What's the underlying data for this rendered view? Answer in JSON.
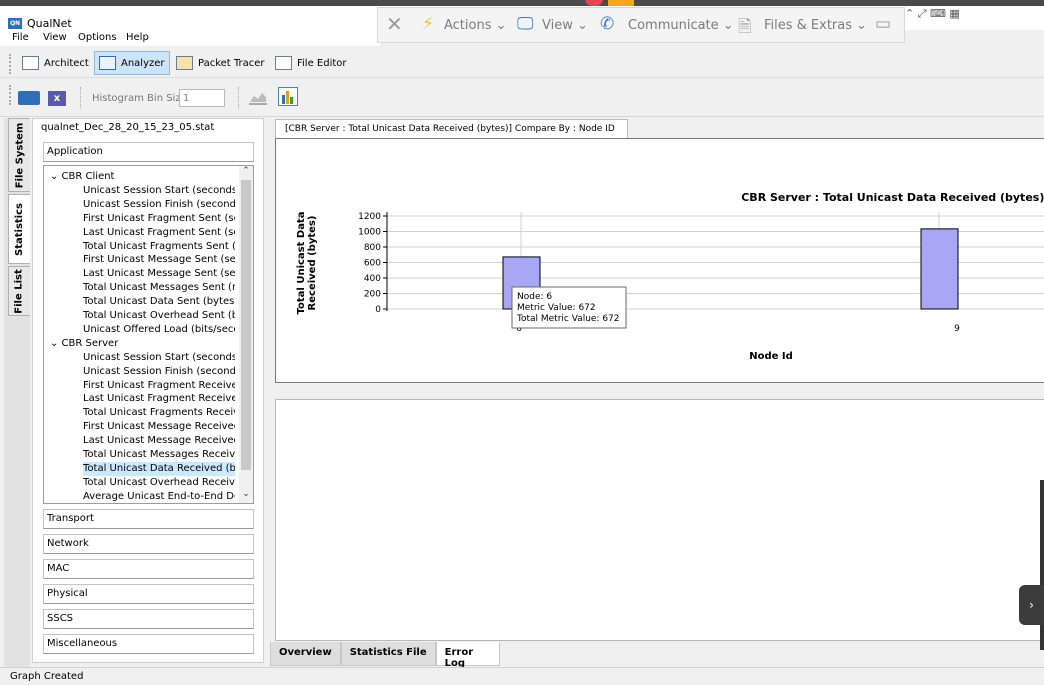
{
  "app": {
    "title": "QualNet",
    "icon_text": "QN",
    "menu": [
      "File",
      "View",
      "Options",
      "Help"
    ]
  },
  "remote_toolbar": {
    "items": [
      {
        "label": "Actions",
        "icon": "lightning-icon"
      },
      {
        "label": "View",
        "icon": "monitor-icon"
      },
      {
        "label": "Communicate",
        "icon": "phone-chat-icon"
      },
      {
        "label": "Files & Extras",
        "icon": "file-transfer-icon"
      }
    ]
  },
  "toolbar": {
    "buttons": [
      {
        "label": "Architect",
        "active": false
      },
      {
        "label": "Analyzer",
        "active": true
      },
      {
        "label": "Packet Tracer",
        "active": false
      },
      {
        "label": "File Editor",
        "active": false
      }
    ],
    "histogram_label": "Histogram Bin Size",
    "histogram_value": "1"
  },
  "left_tabs": [
    "File System",
    "Statistics",
    "File List"
  ],
  "stat_panel": {
    "file_name": "qualnet_Dec_28_20_15_23_05.stat",
    "top_category": "Application",
    "groups": [
      {
        "name": "CBR Client",
        "items": [
          "Unicast Session Start (seconds)",
          "Unicast Session Finish (seconds)",
          "First Unicast Fragment Sent (se...",
          "Last Unicast Fragment Sent (se...",
          "Total Unicast Fragments Sent (f...",
          "First Unicast Message Sent (sec...",
          "Last Unicast Message Sent (sec...",
          "Total Unicast Messages Sent (m...",
          "Total Unicast Data Sent (bytes)",
          "Total Unicast Overhead Sent (b...",
          "Unicast Offered Load (bits/seco..."
        ]
      },
      {
        "name": "CBR Server",
        "items": [
          "Unicast Session Start (seconds)",
          "Unicast Session Finish (seconds)",
          "First Unicast Fragment Receive...",
          "Last Unicast Fragment Receive...",
          "Total Unicast Fragments Receiv...",
          "First Unicast Message Received...",
          "Last Unicast Message Received...",
          "Total Unicast Messages Receiv...",
          "Total Unicast Data Received (b...",
          "Total Unicast Overhead Receiv...",
          "Average Unicast End-to-End De..."
        ]
      }
    ],
    "selected_item": "Total Unicast Data Received (b...",
    "categories": [
      "Transport",
      "Network",
      "MAC",
      "Physical",
      "SSCS",
      "Miscellaneous"
    ]
  },
  "chart_tab_label": "[CBR Server :  Total Unicast Data Received (bytes)] Compare By : Node ID",
  "chart_data": {
    "type": "bar",
    "title": "CBR Server :  Total Unicast Data Received (bytes), Comparison Type: Node",
    "xlabel": "Node Id",
    "ylabel_lines": [
      "Total Unicast Data",
      "Received (bytes)"
    ],
    "categories": [
      "6",
      "9"
    ],
    "values": [
      672,
      1034
    ],
    "ylim": [
      0,
      1200
    ],
    "yticks": [
      0,
      200,
      400,
      600,
      800,
      1000,
      1200
    ],
    "grid": true,
    "bar_color": "#a7a7f5",
    "tooltip": {
      "node": "Node: 6",
      "metric": "Metric Value: 672",
      "total": "Total Metric Value: 672"
    }
  },
  "bottom_tabs": [
    {
      "label": "Overview",
      "selected": false
    },
    {
      "label": "Statistics File",
      "selected": false
    },
    {
      "label": "Error Log",
      "selected": true
    }
  ],
  "status": "Graph Created"
}
